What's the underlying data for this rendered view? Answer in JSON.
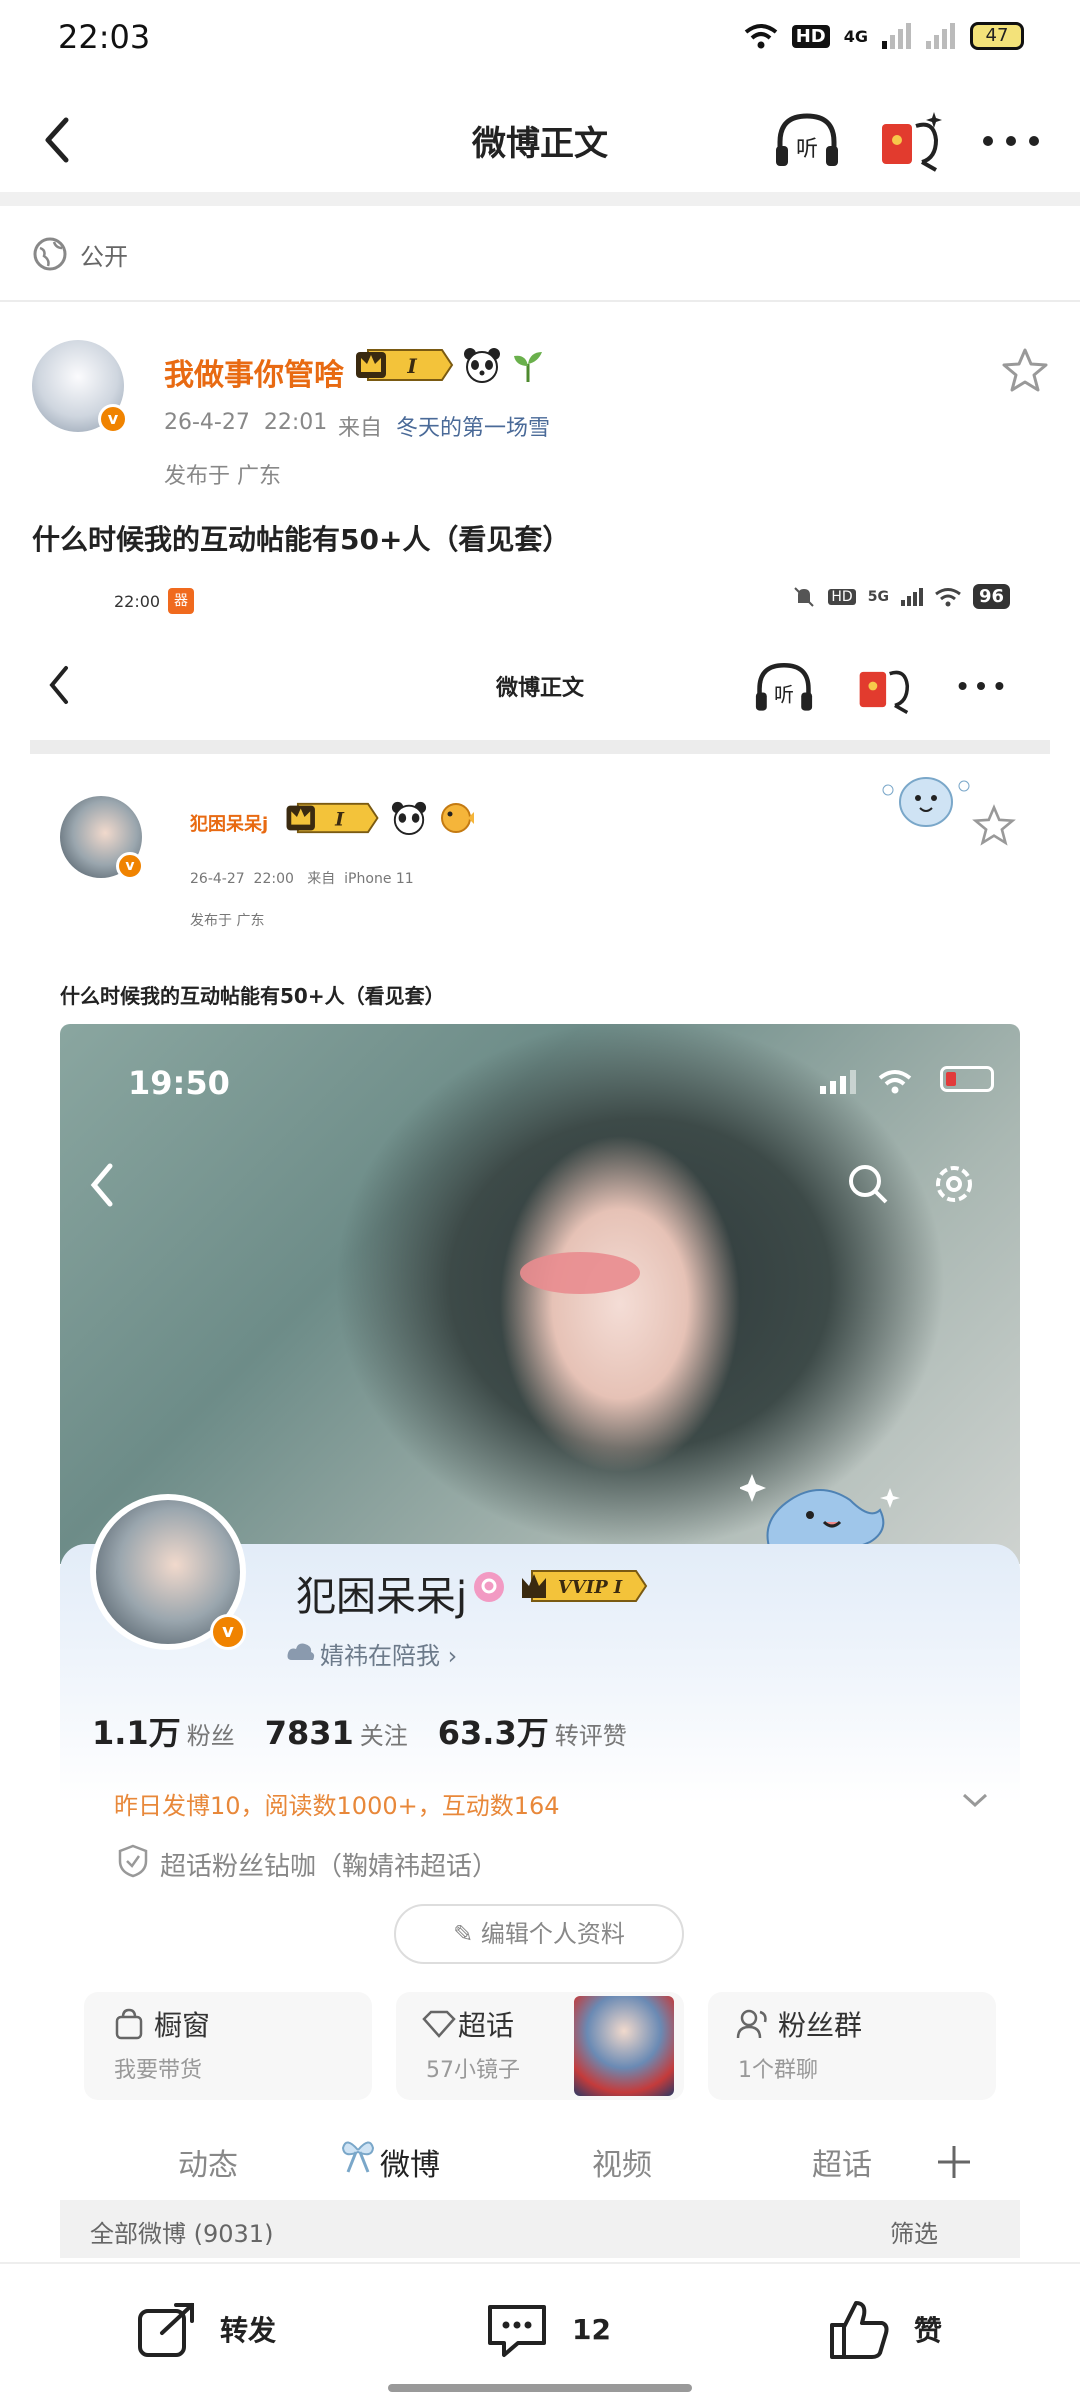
{
  "status_bar": {
    "time": "22:03",
    "network": "4G",
    "battery": "47"
  },
  "header": {
    "title": "微博正文",
    "listen_icon": "listen-headphones",
    "redpack_icon": "red-packet",
    "more_icon": "more-dots"
  },
  "visibility": {
    "label": "公开"
  },
  "post": {
    "author": "我做事你管啥",
    "member_badge": "I",
    "date": "26-4-27",
    "time": "22:01",
    "from_label": "来自",
    "source": "冬天的第一场雪",
    "location": "发布于  广东",
    "text": "什么时候我的互动帖能有50+人（看见套）"
  },
  "embedded": {
    "status_time": "22:00",
    "notif_glyph": "器",
    "status_right": [
      "HD",
      "5G"
    ],
    "battery": "96",
    "title": "微博正文",
    "author": "犯困呆呆j",
    "member_badge": "I",
    "date": "26-4-27",
    "time": "22:00",
    "from_label": "来自",
    "source": "iPhone  11",
    "location": "发布于  广东",
    "text": "什么时候我的互动帖能有50+人（看见套）",
    "profile": {
      "status_time": "19:50",
      "name": "犯困呆呆j",
      "vip": "VVIP",
      "vip_level": "I",
      "with_text": "婧祎在陪我",
      "stats": [
        {
          "value": "1.1万",
          "unit": "粉丝"
        },
        {
          "value": "7831",
          "unit": "关注"
        },
        {
          "value": "63.3万",
          "unit": "转评赞"
        }
      ],
      "daily": "昨日发博10，阅读数1000+，互动数164",
      "super_topic": "超话粉丝钻咖（鞠婧祎超话）",
      "edit_label": "编辑个人资料",
      "tiles": [
        {
          "title": "橱窗",
          "sub": "我要带货"
        },
        {
          "title": "超话",
          "sub": "57小镜子"
        },
        {
          "title": "粉丝群",
          "sub": "1个群聊"
        }
      ],
      "tabs": [
        "动态",
        "微博",
        "视频",
        "超话"
      ],
      "all_weibo": "全部微博 (9031)",
      "filter": "筛选"
    }
  },
  "actions": {
    "repost": "转发",
    "comment_count": "12",
    "like": "赞"
  },
  "colors": {
    "accent": "#e86a12",
    "link": "#4a6a98",
    "vbadge": "#f08300"
  }
}
